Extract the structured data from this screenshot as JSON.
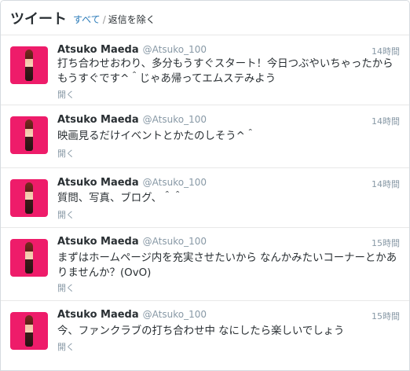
{
  "header": {
    "title": "ツイート",
    "filter_all": "すべて",
    "filter_separator": "/",
    "filter_no_replies": "返信を除く"
  },
  "tweets": [
    {
      "name": "Atsuko Maeda",
      "handle": "@Atsuko_100",
      "time": "14時間",
      "text": "打ち合わせおわり、多分もうすぐスタート！今日つぶやいちゃったからもうすぐです^＾じゃあ帰ってエムステみよう",
      "open": "開く"
    },
    {
      "name": "Atsuko Maeda",
      "handle": "@Atsuko_100",
      "time": "14時間",
      "text": "映画見るだけイベントとかたのしそう^＾",
      "open": "開く"
    },
    {
      "name": "Atsuko Maeda",
      "handle": "@Atsuko_100",
      "time": "14時間",
      "text": "質問、写真、ブログ、＾＾",
      "open": "開く"
    },
    {
      "name": "Atsuko Maeda",
      "handle": "@Atsuko_100",
      "time": "15時間",
      "text": "まずはホームページ内を充実させたいから なんかみたいコーナーとかありませんか？(OvO)",
      "open": "開く"
    },
    {
      "name": "Atsuko Maeda",
      "handle": "@Atsuko_100",
      "time": "15時間",
      "text": "今、ファンクラブの打ち合わせ中 なにしたら楽しいでしょう",
      "open": "開く"
    }
  ]
}
